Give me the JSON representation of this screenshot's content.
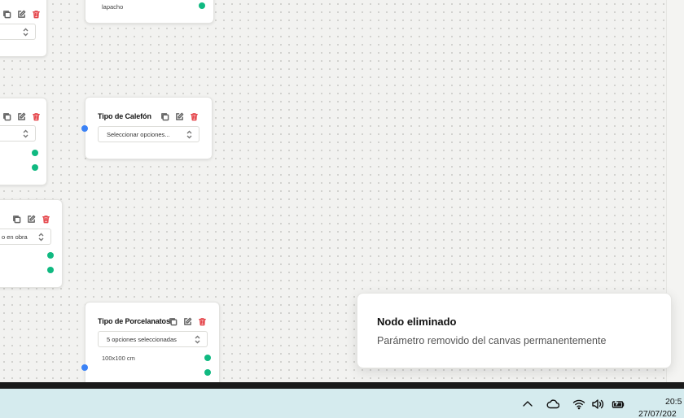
{
  "canvas": {
    "nodes": [
      {
        "id": "n1",
        "title": "",
        "select": "...",
        "options": []
      },
      {
        "id": "n2",
        "title": "",
        "select": "",
        "options": [
          "lapacho"
        ]
      },
      {
        "id": "n3",
        "title": "",
        "select": "",
        "options": []
      },
      {
        "id": "n4",
        "title": "Tipo de Calefón",
        "select": "Seleccionar opciones...",
        "options": []
      },
      {
        "id": "n5",
        "title": "",
        "select": "o en obra",
        "options": []
      },
      {
        "id": "n6",
        "title": "Tipo de Porcelanatos",
        "select": "5 opciones seleccionadas",
        "options": [
          "100x100 cm"
        ]
      }
    ],
    "icons": {
      "copy": "copy-icon",
      "edit": "edit-icon",
      "delete": "trash-icon",
      "select_arrows": "chevron-up-down-icon"
    },
    "colors": {
      "delete": "#e5484d",
      "output_handle": "#10b981",
      "input_handle": "#3b82f6"
    }
  },
  "toast": {
    "title": "Nodo eliminado",
    "description": "Parámetro removido del canvas permanentemente"
  },
  "taskbar": {
    "tray_icons": [
      "chevron-up-icon",
      "cloud-icon",
      "wifi-icon",
      "volume-icon",
      "battery-icon"
    ],
    "time": "20:5",
    "date": "27/07/202"
  }
}
